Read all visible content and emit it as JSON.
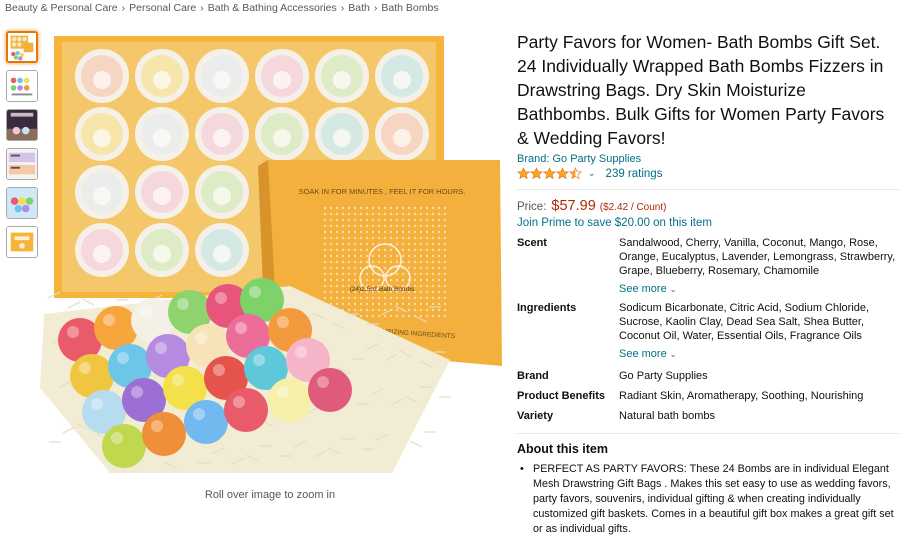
{
  "breadcrumb": {
    "items": [
      "Beauty & Personal Care",
      "Personal Care",
      "Bath & Bathing Accessories",
      "Bath",
      "Bath Bombs"
    ],
    "separator": "›"
  },
  "gallery": {
    "thumbnail_count": 6,
    "active_index": 0,
    "zoom_hint": "Roll over image to zoom in",
    "box_text": {
      "tagline": "SOAK IN FOR MINUTES , FEEL IT FOR HOURS.",
      "count": "(24)2.5oz Bath Bombs",
      "footer": "WITH ORGANIC & MOISTURIZING INGREDIENTS"
    }
  },
  "product": {
    "title": "Party Favors for Women- Bath Bombs Gift Set. 24 Individually Wrapped Bath Bombs Fizzers in Drawstring Bags. Dry Skin Moisturize Bathbombs. Bulk Gifts for Women Party Favors & Wedding Favors!",
    "brand_link": "Brand: Go Party Supplies",
    "rating": 4.5,
    "ratings_count": "239 ratings",
    "price_label": "Price:",
    "price": "$57.99",
    "unit_price": "($2.42 / Count)",
    "prime_promo": "Join Prime to save $20.00 on this item"
  },
  "specs": {
    "scent": {
      "key": "Scent",
      "value": "Sandalwood, Cherry, Vanilla, Coconut, Mango, Rose, Orange, Eucalyptus, Lavender, Lemongrass, Strawberry, Grape, Blueberry, Rosemary, Chamomile"
    },
    "ingredients": {
      "key": "Ingredients",
      "value": "Sodicum Bicarbonate, Citric Acid, Sodium Chloride, Sucrose, Kaolin Clay, Dead Sea Salt, Shea Butter, Coconut Oil, Water, Essential Oils, Fragrance Oils"
    },
    "brand": {
      "key": "Brand",
      "value": "Go Party Supplies"
    },
    "benefits": {
      "key": "Product Benefits",
      "value": "Radiant Skin, Aromatherapy, Soothing, Nourishing"
    },
    "variety": {
      "key": "Variety",
      "value": "Natural bath bombs"
    },
    "see_more": "See more"
  },
  "about": {
    "title": "About this item",
    "bullets": [
      "PERFECT AS PARTY FAVORS: These 24 Bombs are in individual Elegant Mesh Drawstring Gift Bags . Makes this set easy to use as wedding favors, party favors, souvenirs, individual gifting & when creating individually customized gift baskets. Comes in a beautiful gift box makes a great gift set or as individual gifts."
    ]
  },
  "colors": {
    "link": "#007185",
    "price": "#b12704",
    "star": "#ffa41c",
    "box_orange": "#f6b53a"
  },
  "icons": [
    "star-icon",
    "chevron-down-icon"
  ]
}
